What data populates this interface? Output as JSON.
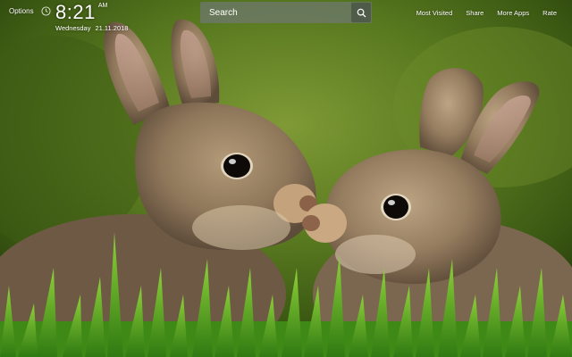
{
  "topbar": {
    "options_label": "Options",
    "clock_icon": "clock-icon"
  },
  "clock": {
    "time": "8:21",
    "ampm": "AM",
    "weekday": "Wednesday",
    "date": "21.11.2018"
  },
  "search": {
    "placeholder": "Search",
    "button_icon": "search-icon"
  },
  "nav": {
    "most_visited": "Most Visited",
    "share": "Share",
    "more_apps": "More Apps",
    "rate": "Rate"
  },
  "wallpaper": {
    "subject": "rabbit-pair-wallpaper"
  },
  "colors": {
    "text": "#ffffff",
    "search_bg": "#6e786e",
    "background_green": "#4f6e1c"
  }
}
